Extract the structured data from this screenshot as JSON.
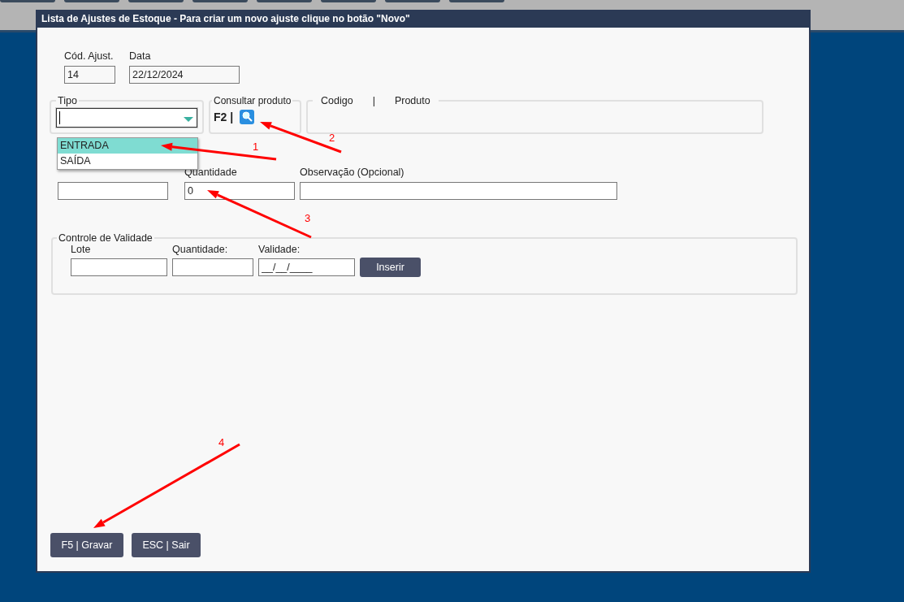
{
  "window": {
    "title": "Lista de Ajustes de Estoque - Para criar um novo ajuste clique no botão \"Novo\""
  },
  "header_fields": [
    {
      "label": "Cód. Ajust.",
      "value": "14"
    },
    {
      "label": "Data",
      "value": "22/12/2024"
    }
  ],
  "tipo": {
    "legend": "Tipo",
    "expanded": true,
    "options": [
      {
        "label": "ENTRADA",
        "selected": true
      },
      {
        "label": "SAÍDA",
        "selected": false
      }
    ]
  },
  "consultar": {
    "legend": "Consultar produto",
    "shortcut": "F2 |"
  },
  "produto_box": {
    "legend_codigo": "Codigo",
    "separator": "|",
    "legend_produto": "Produto"
  },
  "quantity_fields": [
    {
      "label": "Quantidade",
      "value": "0"
    },
    {
      "label": "Observação (Opcional)"
    }
  ],
  "validade": {
    "legend": "Controle de Validade",
    "fields": [
      {
        "label": "Lote"
      },
      {
        "label": "Quantidade:"
      },
      {
        "label": "Validade:",
        "value": "__/__/____"
      }
    ],
    "button": "Inserir"
  },
  "buttons": [
    "F5 | Gravar",
    "ESC | Sair"
  ],
  "annotations": [
    "1",
    "2",
    "3",
    "4"
  ]
}
